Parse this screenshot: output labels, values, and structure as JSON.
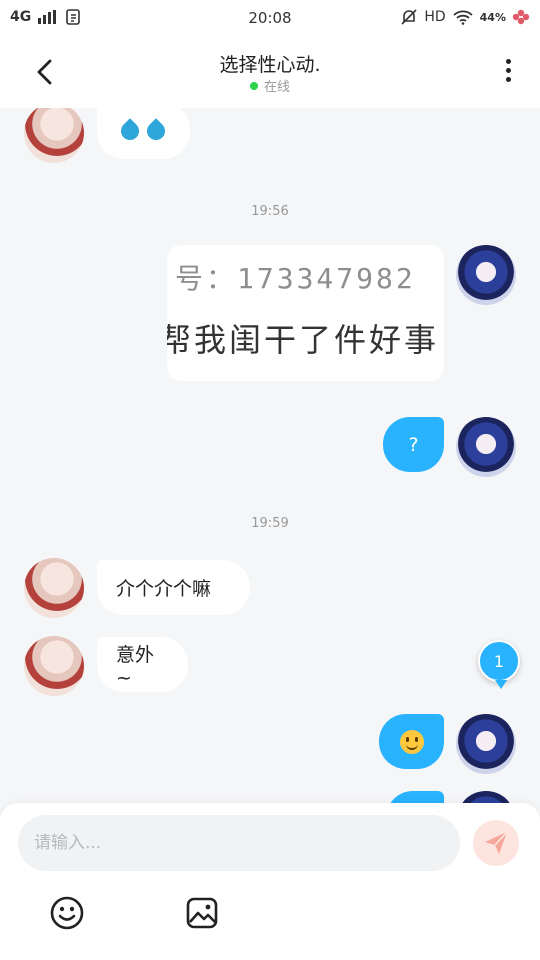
{
  "status_bar": {
    "network": "4G",
    "time": "20:08",
    "hd": "HD",
    "battery": "44%"
  },
  "header": {
    "title": "选择性心动.",
    "status": "在线"
  },
  "messages": {
    "time_1": "19:56",
    "image_text_1": "号：173347982",
    "image_text_2": "帮我闺干了件好事",
    "question": "?",
    "time_2": "19:59",
    "peer_text_1": "介个介个嘛",
    "peer_text_2": "意外~"
  },
  "badge": {
    "count": "1"
  },
  "composer": {
    "placeholder": "请输入..."
  },
  "colors": {
    "accent": "#29b3ff",
    "online": "#2bd44b",
    "send_button": "#fde4df"
  },
  "icons": [
    "back-icon",
    "more-icon",
    "send-icon",
    "emoji-icon",
    "image-icon"
  ]
}
